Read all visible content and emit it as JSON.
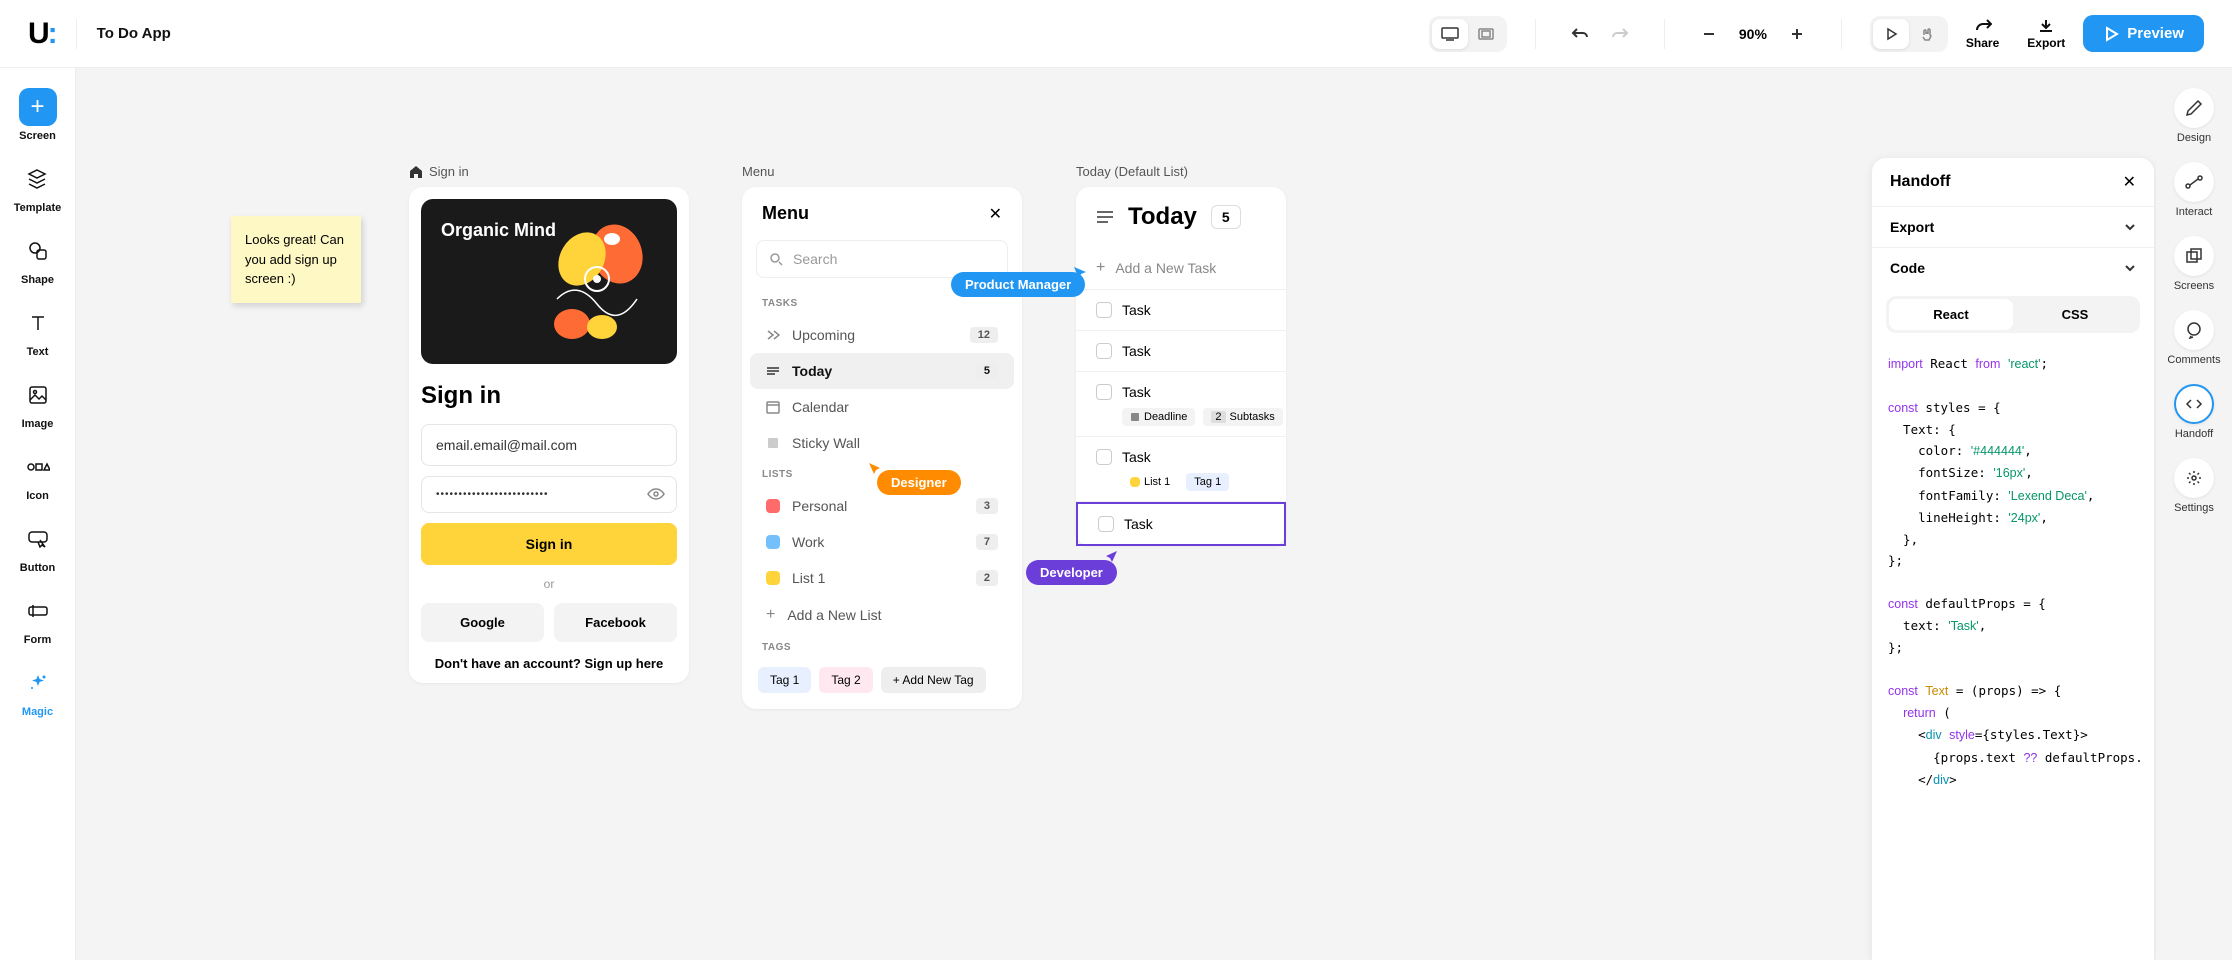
{
  "header": {
    "app_title": "To Do App",
    "zoom": "90%",
    "share": "Share",
    "export": "Export",
    "preview": "Preview"
  },
  "left_tools": [
    {
      "id": "screen",
      "label": "Screen"
    },
    {
      "id": "template",
      "label": "Template"
    },
    {
      "id": "shape",
      "label": "Shape"
    },
    {
      "id": "text",
      "label": "Text"
    },
    {
      "id": "image",
      "label": "Image"
    },
    {
      "id": "icon",
      "label": "Icon"
    },
    {
      "id": "button",
      "label": "Button"
    },
    {
      "id": "form",
      "label": "Form"
    },
    {
      "id": "magic",
      "label": "Magic"
    }
  ],
  "sticky": {
    "text": "Looks great! Can you add sign up screen :)"
  },
  "signin": {
    "artboard_label": "Sign in",
    "hero_title": "Organic Mind",
    "title": "Sign in",
    "email": "email.email@mail.com",
    "password_mask": "•••••••••••••••••••••••••",
    "submit": "Sign in",
    "or": "or",
    "google": "Google",
    "facebook": "Facebook",
    "footer": "Don't have an account? Sign up here"
  },
  "menu": {
    "artboard_label": "Menu",
    "title": "Menu",
    "search_placeholder": "Search",
    "tasks_label": "TASKS",
    "lists_label": "LISTS",
    "tags_label": "TAGS",
    "tasks": [
      {
        "id": "upcoming",
        "label": "Upcoming",
        "count": "12"
      },
      {
        "id": "today",
        "label": "Today",
        "count": "5"
      },
      {
        "id": "calendar",
        "label": "Calendar",
        "count": ""
      },
      {
        "id": "sticky",
        "label": "Sticky Wall",
        "count": ""
      }
    ],
    "lists": [
      {
        "label": "Personal",
        "count": "3",
        "color": "#ff6b6b"
      },
      {
        "label": "Work",
        "count": "7",
        "color": "#74c0fc"
      },
      {
        "label": "List 1",
        "count": "2",
        "color": "#ffd43b"
      }
    ],
    "add_list": "Add a New List",
    "tags": [
      "Tag 1",
      "Tag 2",
      "+ Add New Tag"
    ]
  },
  "today": {
    "artboard_label": "Today (Default List)",
    "title": "Today",
    "count": "5",
    "add_task": "Add a New Task",
    "tasks": [
      {
        "label": "Task"
      },
      {
        "label": "Task"
      },
      {
        "label": "Task",
        "meta": [
          {
            "text": "Deadline",
            "icon": "cal"
          },
          {
            "text": "Subtasks",
            "badge": "2"
          }
        ]
      },
      {
        "label": "Task",
        "meta": [
          {
            "text": "List 1",
            "swatch": "#ffd43b"
          },
          {
            "text": "Tag 1",
            "tag": true
          }
        ]
      },
      {
        "label": "Task",
        "selected": true
      }
    ]
  },
  "cursors": {
    "pm": "Product Manager",
    "designer": "Designer",
    "developer": "Developer"
  },
  "handoff": {
    "title": "Handoff",
    "export": "Export",
    "code": "Code",
    "tabs": {
      "react": "React",
      "css": "CSS"
    }
  },
  "right_tools": [
    {
      "id": "design",
      "label": "Design"
    },
    {
      "id": "interact",
      "label": "Interact"
    },
    {
      "id": "screens",
      "label": "Screens"
    },
    {
      "id": "comments",
      "label": "Comments"
    },
    {
      "id": "handoff",
      "label": "Handoff",
      "active": true
    },
    {
      "id": "settings",
      "label": "Settings"
    }
  ]
}
